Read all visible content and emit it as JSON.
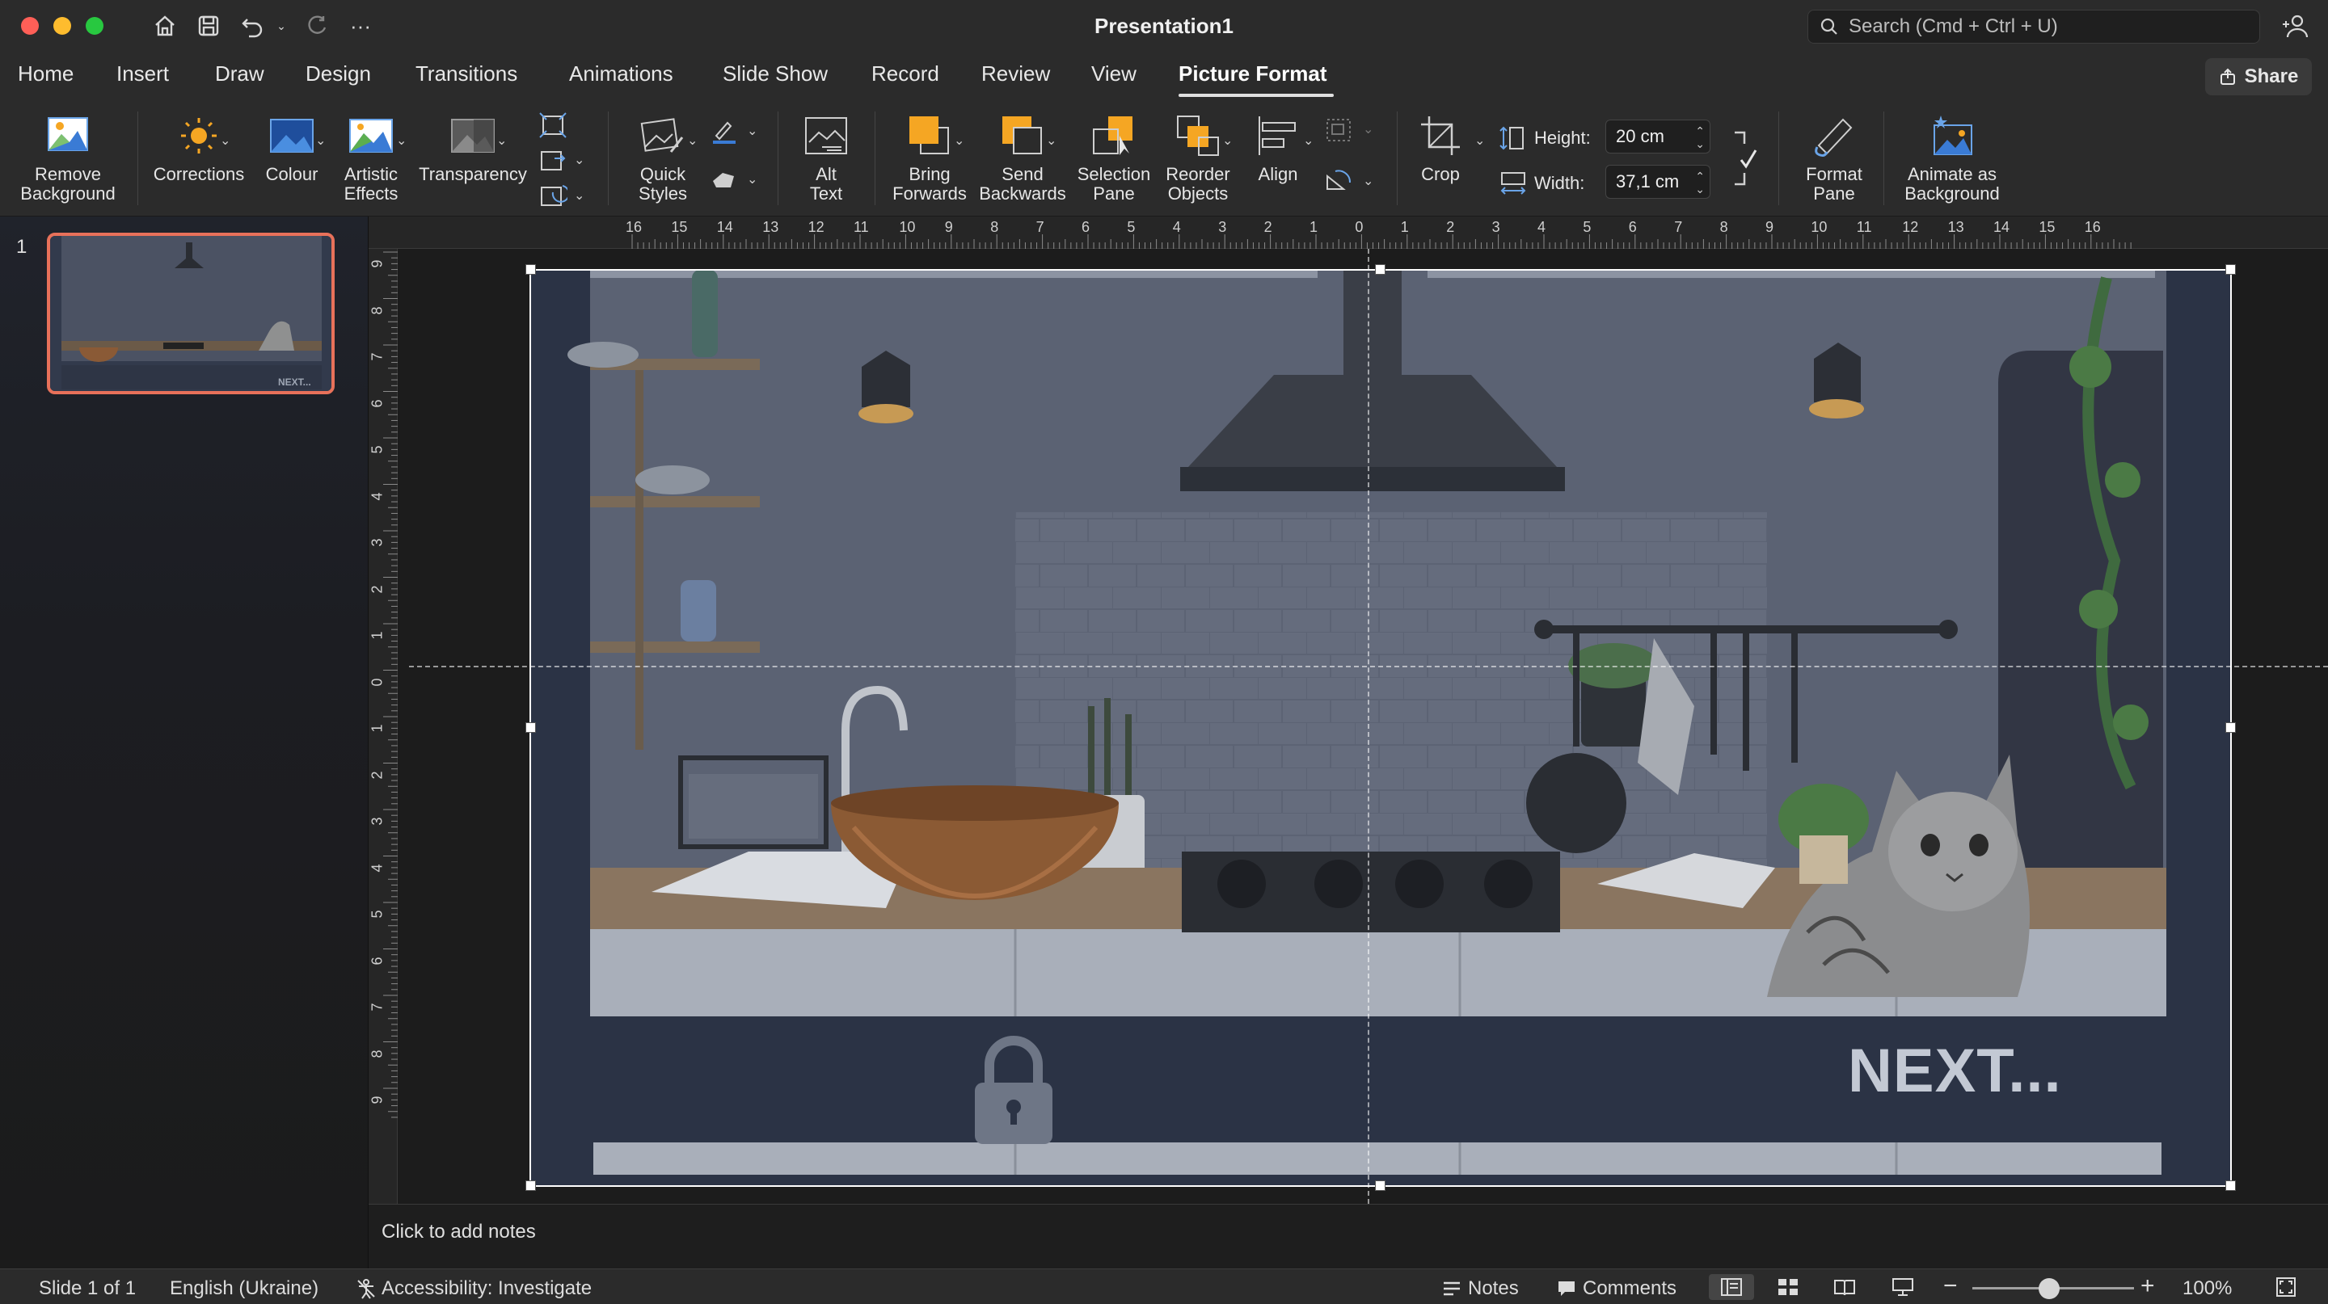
{
  "window": {
    "title": "Presentation1",
    "search_placeholder": "Search (Cmd + Ctrl + U)"
  },
  "quick_access": {
    "icons": [
      "home-icon",
      "save-icon",
      "undo-icon",
      "redo-icon",
      "more-icon"
    ]
  },
  "tabs": [
    {
      "label": "Home"
    },
    {
      "label": "Insert"
    },
    {
      "label": "Draw"
    },
    {
      "label": "Design"
    },
    {
      "label": "Transitions"
    },
    {
      "label": "Animations"
    },
    {
      "label": "Slide Show"
    },
    {
      "label": "Record"
    },
    {
      "label": "Review"
    },
    {
      "label": "View"
    },
    {
      "label": "Picture Format",
      "active": true
    }
  ],
  "share_label": "Share",
  "ribbon": {
    "remove_background": "Remove\nBackground",
    "corrections": "Corrections",
    "colour": "Colour",
    "artistic_effects": "Artistic\nEffects",
    "transparency": "Transparency",
    "quick_styles": "Quick\nStyles",
    "alt_text": "Alt\nText",
    "bring_forwards": "Bring\nForwards",
    "send_backwards": "Send\nBackwards",
    "selection_pane": "Selection\nPane",
    "reorder_objects": "Reorder\nObjects",
    "align": "Align",
    "crop": "Crop",
    "height_label": "Height:",
    "height_value": "20 cm",
    "width_label": "Width:",
    "width_value": "37,1 cm",
    "format_pane": "Format\nPane",
    "animate_as_background": "Animate as\nBackground"
  },
  "slides_panel": {
    "slide_number": "1",
    "thumb_text": "NEXT..."
  },
  "ruler": {
    "horizontal": [
      "16",
      "15",
      "14",
      "13",
      "12",
      "11",
      "10",
      "9",
      "8",
      "7",
      "6",
      "5",
      "4",
      "3",
      "2",
      "1",
      "0",
      "1",
      "2",
      "3",
      "4",
      "5",
      "6",
      "7",
      "8",
      "9",
      "10",
      "11",
      "12",
      "13",
      "14",
      "15",
      "16"
    ],
    "vertical": [
      "9",
      "8",
      "7",
      "6",
      "5",
      "4",
      "3",
      "2",
      "1",
      "0",
      "1",
      "2",
      "3",
      "4",
      "5",
      "6",
      "7",
      "8",
      "9"
    ]
  },
  "slide": {
    "next_text": "NEXT..."
  },
  "notes_placeholder": "Click to add notes",
  "status": {
    "slide_info": "Slide 1 of 1",
    "language": "English (Ukraine)",
    "accessibility": "Accessibility: Investigate",
    "notes": "Notes",
    "comments": "Comments",
    "zoom": "100%"
  },
  "colors": {
    "accent_orange": "#f5a623",
    "thumb_border": "#e8715a",
    "chrome": "#2b2b2b"
  }
}
